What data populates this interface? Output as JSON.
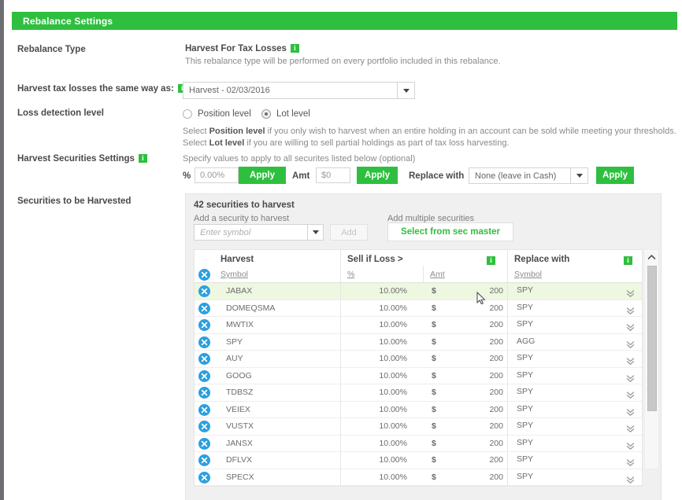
{
  "header": {
    "title": "Rebalance Settings"
  },
  "colors": {
    "accent_green": "#2fbf3f",
    "info_icon_green": "#2fbf3f",
    "delete_icon_blue": "#2c9fe0",
    "row_highlight": "#eef7e0",
    "panel_bg": "#f0f0f0"
  },
  "form": {
    "rebalance_type": {
      "label": "Rebalance Type",
      "value": "Harvest For Tax Losses",
      "info_icon": "info-icon",
      "description": "This rebalance type will be performed on every portfolio included in this rebalance."
    },
    "harvest_same_way": {
      "label": "Harvest tax losses the same way as:",
      "info_icon": "info-icon",
      "selected": "Harvest - 02/03/2016",
      "caret_icon": "chevron-down-icon"
    },
    "loss_detection": {
      "label": "Loss detection level",
      "options": [
        {
          "label": "Position level",
          "checked": false
        },
        {
          "label": "Lot level",
          "checked": true
        }
      ],
      "help_line_1_pre": "Select ",
      "help_line_1_bold": "Position level",
      "help_line_1_post": " if you only wish to harvest when an entire holding in an account can be sold while meeting your thresholds.",
      "help_line_2_pre": "Select ",
      "help_line_2_bold": "Lot level",
      "help_line_2_post": " if you are willing to sell partial holdings as part of tax loss harvesting."
    },
    "harvest_securities_settings": {
      "label": "Harvest Securities Settings",
      "info_icon": "info-icon",
      "instructions": "Specify values to apply to all securites listed below (optional)",
      "pct_label": "%",
      "pct_value": "0.00%",
      "pct_apply_label": "Apply",
      "amt_label": "Amt",
      "amt_value": "$0",
      "amt_apply_label": "Apply",
      "replace_label": "Replace with",
      "replace_value": "None (leave in Cash)",
      "replace_caret_icon": "chevron-down-icon",
      "replace_apply_label": "Apply"
    }
  },
  "securities": {
    "row_label": "Securities to be Harvested",
    "count_text": "42 securities to harvest",
    "add_single_label": "Add a security to harvest",
    "symbol_placeholder": "Enter symbol",
    "symbol_caret_icon": "chevron-down-icon",
    "add_button_label": "Add",
    "add_multiple_label": "Add multiple securities",
    "sec_master_button_label": "Select from sec master",
    "table": {
      "group_headers": [
        {
          "label": "Harvest",
          "info_icon": null
        },
        {
          "label": "Sell if Loss >",
          "info_icon": "info-icon"
        },
        {
          "label": "Replace with",
          "info_icon": "info-icon"
        }
      ],
      "sub_headers": [
        "Symbol",
        "%",
        "Amt",
        "Symbol"
      ],
      "rows": [
        {
          "symbol": "JABAX",
          "pct": "10.00%",
          "currency": "$",
          "amt": "200",
          "replace": "SPY",
          "highlight": true
        },
        {
          "symbol": "DOMEQSMA",
          "pct": "10.00%",
          "currency": "$",
          "amt": "200",
          "replace": "SPY",
          "highlight": false
        },
        {
          "symbol": "MWTIX",
          "pct": "10.00%",
          "currency": "$",
          "amt": "200",
          "replace": "SPY",
          "highlight": false
        },
        {
          "symbol": "SPY",
          "pct": "10.00%",
          "currency": "$",
          "amt": "200",
          "replace": "AGG",
          "highlight": false
        },
        {
          "symbol": "AUY",
          "pct": "10.00%",
          "currency": "$",
          "amt": "200",
          "replace": "SPY",
          "highlight": false
        },
        {
          "symbol": "GOOG",
          "pct": "10.00%",
          "currency": "$",
          "amt": "200",
          "replace": "SPY",
          "highlight": false
        },
        {
          "symbol": "TDBSZ",
          "pct": "10.00%",
          "currency": "$",
          "amt": "200",
          "replace": "SPY",
          "highlight": false
        },
        {
          "symbol": "VEIEX",
          "pct": "10.00%",
          "currency": "$",
          "amt": "200",
          "replace": "SPY",
          "highlight": false
        },
        {
          "symbol": "VUSTX",
          "pct": "10.00%",
          "currency": "$",
          "amt": "200",
          "replace": "SPY",
          "highlight": false
        },
        {
          "symbol": "JANSX",
          "pct": "10.00%",
          "currency": "$",
          "amt": "200",
          "replace": "SPY",
          "highlight": false
        },
        {
          "symbol": "DFLVX",
          "pct": "10.00%",
          "currency": "$",
          "amt": "200",
          "replace": "SPY",
          "highlight": false
        },
        {
          "symbol": "SPECX",
          "pct": "10.00%",
          "currency": "$",
          "amt": "200",
          "replace": "SPY",
          "highlight": false
        }
      ],
      "row_delete_icon": "delete-circle-icon",
      "row_expand_icon": "double-chevron-down-icon"
    },
    "scrollbar": {
      "up_icon": "chevron-up-icon"
    }
  }
}
